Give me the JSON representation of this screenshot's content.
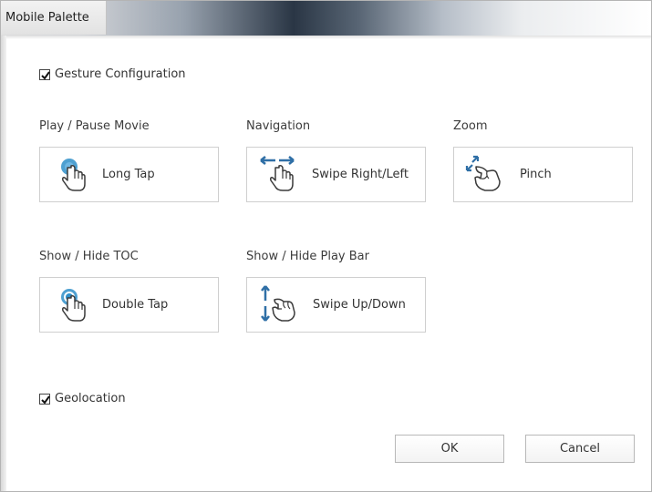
{
  "window": {
    "title": "Mobile Palette"
  },
  "gesture_configuration": {
    "label": "Gesture Configuration",
    "checked": true
  },
  "gestures": [
    {
      "section": "Play / Pause Movie",
      "label": "Long Tap",
      "icon": "long-tap-icon"
    },
    {
      "section": "Navigation",
      "label": "Swipe Right/Left",
      "icon": "swipe-horizontal-icon"
    },
    {
      "section": "Zoom",
      "label": "Pinch",
      "icon": "pinch-icon"
    },
    {
      "section": "Show / Hide TOC",
      "label": "Double Tap",
      "icon": "double-tap-icon"
    },
    {
      "section": "Show / Hide Play Bar",
      "label": "Swipe Up/Down",
      "icon": "swipe-vertical-icon"
    }
  ],
  "geolocation": {
    "label": "Geolocation",
    "checked": true
  },
  "buttons": {
    "ok": "OK",
    "cancel": "Cancel"
  },
  "colors": {
    "accent_blue": "#2f8fc9",
    "hand_stroke": "#3a3a3a"
  }
}
